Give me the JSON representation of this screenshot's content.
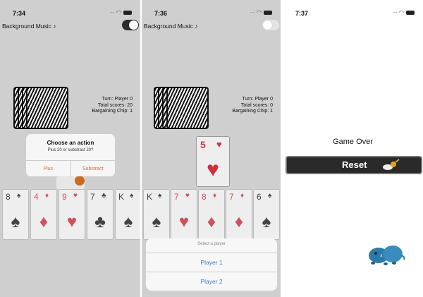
{
  "panels": [
    {
      "time": "7:34",
      "background_music_label": "Background Music",
      "music_toggle": "on",
      "info": {
        "turn": "Turn: Player 0",
        "total": "Total scores: 20",
        "chip": "Bargaining Chip: 1"
      },
      "hand": [
        {
          "rank": "8",
          "suit": "spade",
          "color": "black"
        },
        {
          "rank": "4",
          "suit": "diamond",
          "color": "red"
        },
        {
          "rank": "9",
          "suit": "heart",
          "color": "red"
        },
        {
          "rank": "7",
          "suit": "club",
          "color": "black"
        },
        {
          "rank": "K",
          "suit": "spade",
          "color": "black"
        }
      ],
      "dialog": {
        "title": "Choose an action",
        "message": "Plus 20 or substract 20?",
        "buttons": [
          "Plus",
          "Substract"
        ]
      }
    },
    {
      "time": "7:36",
      "background_music_label": "Background Music",
      "music_toggle": "off",
      "info": {
        "turn": "Turn: Player 0",
        "total": "Total scores: 0",
        "chip": "Bargaining Chip: 1"
      },
      "middle_card": {
        "rank": "5",
        "suit": "heart",
        "color": "red"
      },
      "hand": [
        {
          "rank": "K",
          "suit": "spade",
          "color": "black"
        },
        {
          "rank": "7",
          "suit": "heart",
          "color": "red"
        },
        {
          "rank": "8",
          "suit": "diamond",
          "color": "red"
        },
        {
          "rank": "7",
          "suit": "diamond",
          "color": "red"
        },
        {
          "rank": "6",
          "suit": "spade",
          "color": "black"
        }
      ],
      "sheet": {
        "title": "Select a player",
        "options": [
          "Player 1",
          "Player 2"
        ]
      }
    },
    {
      "time": "7:37",
      "game_over": "Game Over",
      "reset_label": "Reset"
    }
  ],
  "colors": {
    "game_bg": "#cfcfcf",
    "alert_button": "#e2664d",
    "sheet_button": "#3b7bd4",
    "card_red": "#d0505c",
    "reset_bg": "#2a2a2a"
  },
  "icons": {
    "music": "music-note-icon",
    "toggle": "switch",
    "reset": "bomb-icon",
    "mascot": "blue-piggy-icon"
  }
}
